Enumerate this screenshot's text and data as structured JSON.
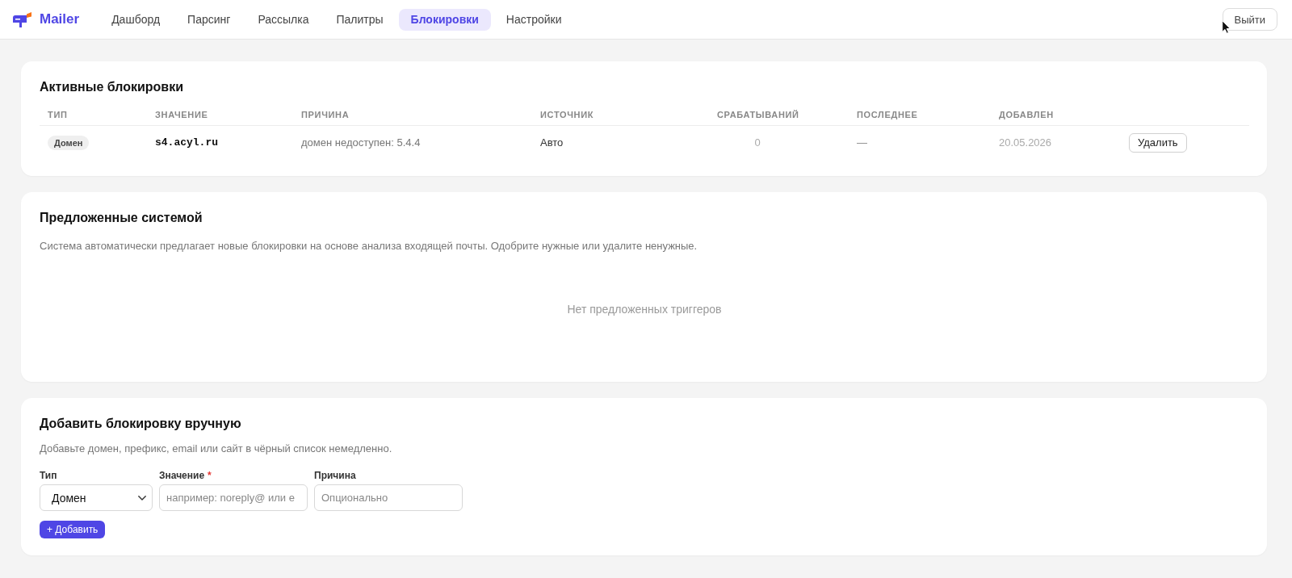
{
  "nav": {
    "logo": "Mailer",
    "tabs": [
      {
        "label": "Дашборд",
        "selected": false
      },
      {
        "label": "Парсинг",
        "selected": false
      },
      {
        "label": "Рассылка",
        "selected": false
      },
      {
        "label": "Палитры",
        "selected": false
      },
      {
        "label": "Блокировки",
        "selected": true
      },
      {
        "label": "Настройки",
        "selected": false
      }
    ],
    "logout": "Выйти"
  },
  "active_blocks": {
    "title": "Активные блокировки",
    "table": {
      "columns": [
        "ТИП",
        "ЗНАЧЕНИЕ",
        "ПРИЧИНА",
        "ИСТОЧНИК",
        "СРАБАТЫВАНИЙ",
        "ПОСЛЕДНЕЕ",
        "ДОБАВЛЕН"
      ],
      "rows": [
        {
          "type": "Домен",
          "value": "s4.acyl.ru",
          "reason": "домен недоступен: 5.4.4",
          "source": "Авто",
          "hits": "0",
          "last": "—",
          "added": "20.05.2026",
          "action": "Удалить"
        }
      ]
    }
  },
  "suggested": {
    "title": "Предложенные системой",
    "description": "Система автоматически предлагает новые блокировки на основе анализа входящей почты. Одобрите нужные или удалите ненужные.",
    "empty": "Нет предложенных триггеров"
  },
  "manual": {
    "title": "Добавить блокировку вручную",
    "description": "Добавьте домен, префикс, email или сайт в чёрный список немедленно.",
    "fields": [
      {
        "kind": "select",
        "label": "Тип",
        "value": "Домен"
      },
      {
        "kind": "text",
        "label": "Значение",
        "required_mark": "*",
        "placeholder": "например: noreply@ или e"
      },
      {
        "kind": "text",
        "label": "Причина",
        "placeholder": "Опционально"
      }
    ],
    "submit": "+ Добавить"
  }
}
